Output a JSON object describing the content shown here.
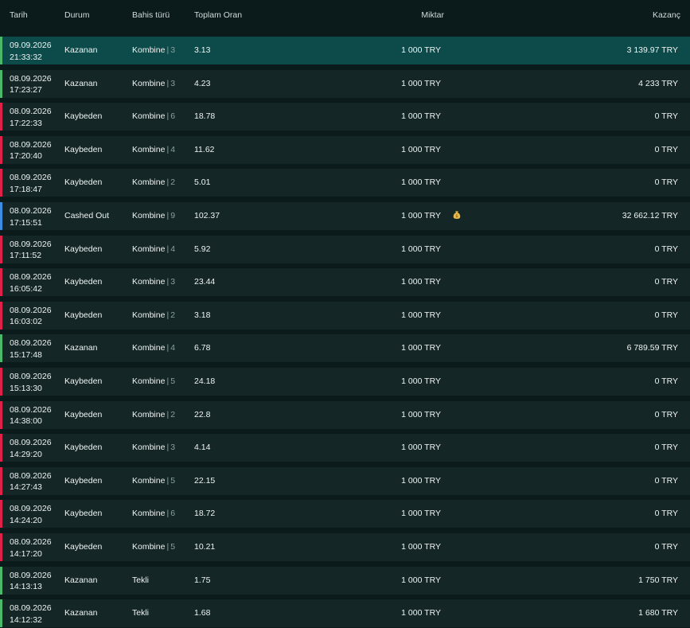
{
  "header": {
    "date": "Tarih",
    "status": "Durum",
    "bet_type": "Bahis türü",
    "total_odds": "Toplam Oran",
    "amount": "Miktar",
    "winnings": "Kazanç"
  },
  "colors": {
    "won": "#4bb86a",
    "lost": "#e0224b",
    "cashed_out": "#3d8ee3",
    "highlight_row": "#0d4a4a",
    "row": "#142626",
    "background": "#0b1a1a"
  },
  "rows": [
    {
      "date": "09.09.2026",
      "time": "21:33:32",
      "status": "Kazanan",
      "kind": "won",
      "type": "Kombine",
      "count": "3",
      "odds": "3.13",
      "amount": "1 000 TRY",
      "win": "3 139.97 TRY",
      "highlight": true
    },
    {
      "date": "08.09.2026",
      "time": "17:23:27",
      "status": "Kazanan",
      "kind": "won",
      "type": "Kombine",
      "count": "3",
      "odds": "4.23",
      "amount": "1 000 TRY",
      "win": "4 233 TRY"
    },
    {
      "date": "08.09.2026",
      "time": "17:22:33",
      "status": "Kaybeden",
      "kind": "lost",
      "type": "Kombine",
      "count": "6",
      "odds": "18.78",
      "amount": "1 000 TRY",
      "win": "0 TRY"
    },
    {
      "date": "08.09.2026",
      "time": "17:20:40",
      "status": "Kaybeden",
      "kind": "lost",
      "type": "Kombine",
      "count": "4",
      "odds": "11.62",
      "amount": "1 000 TRY",
      "win": "0 TRY"
    },
    {
      "date": "08.09.2026",
      "time": "17:18:47",
      "status": "Kaybeden",
      "kind": "lost",
      "type": "Kombine",
      "count": "2",
      "odds": "5.01",
      "amount": "1 000 TRY",
      "win": "0 TRY"
    },
    {
      "date": "08.09.2026",
      "time": "17:15:51",
      "status": "Cashed Out",
      "kind": "cashed",
      "type": "Kombine",
      "count": "9",
      "odds": "102.37",
      "amount": "1 000 TRY",
      "win": "32 662.12 TRY",
      "icon": "money-bag-icon"
    },
    {
      "date": "08.09.2026",
      "time": "17:11:52",
      "status": "Kaybeden",
      "kind": "lost",
      "type": "Kombine",
      "count": "4",
      "odds": "5.92",
      "amount": "1 000 TRY",
      "win": "0 TRY"
    },
    {
      "date": "08.09.2026",
      "time": "16:05:42",
      "status": "Kaybeden",
      "kind": "lost",
      "type": "Kombine",
      "count": "3",
      "odds": "23.44",
      "amount": "1 000 TRY",
      "win": "0 TRY"
    },
    {
      "date": "08.09.2026",
      "time": "16:03:02",
      "status": "Kaybeden",
      "kind": "lost",
      "type": "Kombine",
      "count": "2",
      "odds": "3.18",
      "amount": "1 000 TRY",
      "win": "0 TRY"
    },
    {
      "date": "08.09.2026",
      "time": "15:17:48",
      "status": "Kazanan",
      "kind": "won",
      "type": "Kombine",
      "count": "4",
      "odds": "6.78",
      "amount": "1 000 TRY",
      "win": "6 789.59 TRY"
    },
    {
      "date": "08.09.2026",
      "time": "15:13:30",
      "status": "Kaybeden",
      "kind": "lost",
      "type": "Kombine",
      "count": "5",
      "odds": "24.18",
      "amount": "1 000 TRY",
      "win": "0 TRY"
    },
    {
      "date": "08.09.2026",
      "time": "14:38:00",
      "status": "Kaybeden",
      "kind": "lost",
      "type": "Kombine",
      "count": "2",
      "odds": "22.8",
      "amount": "1 000 TRY",
      "win": "0 TRY"
    },
    {
      "date": "08.09.2026",
      "time": "14:29:20",
      "status": "Kaybeden",
      "kind": "lost",
      "type": "Kombine",
      "count": "3",
      "odds": "4.14",
      "amount": "1 000 TRY",
      "win": "0 TRY"
    },
    {
      "date": "08.09.2026",
      "time": "14:27:43",
      "status": "Kaybeden",
      "kind": "lost",
      "type": "Kombine",
      "count": "5",
      "odds": "22.15",
      "amount": "1 000 TRY",
      "win": "0 TRY"
    },
    {
      "date": "08.09.2026",
      "time": "14:24:20",
      "status": "Kaybeden",
      "kind": "lost",
      "type": "Kombine",
      "count": "6",
      "odds": "18.72",
      "amount": "1 000 TRY",
      "win": "0 TRY"
    },
    {
      "date": "08.09.2026",
      "time": "14:17:20",
      "status": "Kaybeden",
      "kind": "lost",
      "type": "Kombine",
      "count": "5",
      "odds": "10.21",
      "amount": "1 000 TRY",
      "win": "0 TRY"
    },
    {
      "date": "08.09.2026",
      "time": "14:13:13",
      "status": "Kazanan",
      "kind": "won",
      "type": "Tekli",
      "count": "",
      "odds": "1.75",
      "amount": "1 000 TRY",
      "win": "1 750 TRY"
    },
    {
      "date": "08.09.2026",
      "time": "14:12:32",
      "status": "Kazanan",
      "kind": "won",
      "type": "Tekli",
      "count": "",
      "odds": "1.68",
      "amount": "1 000 TRY",
      "win": "1 680 TRY"
    }
  ]
}
